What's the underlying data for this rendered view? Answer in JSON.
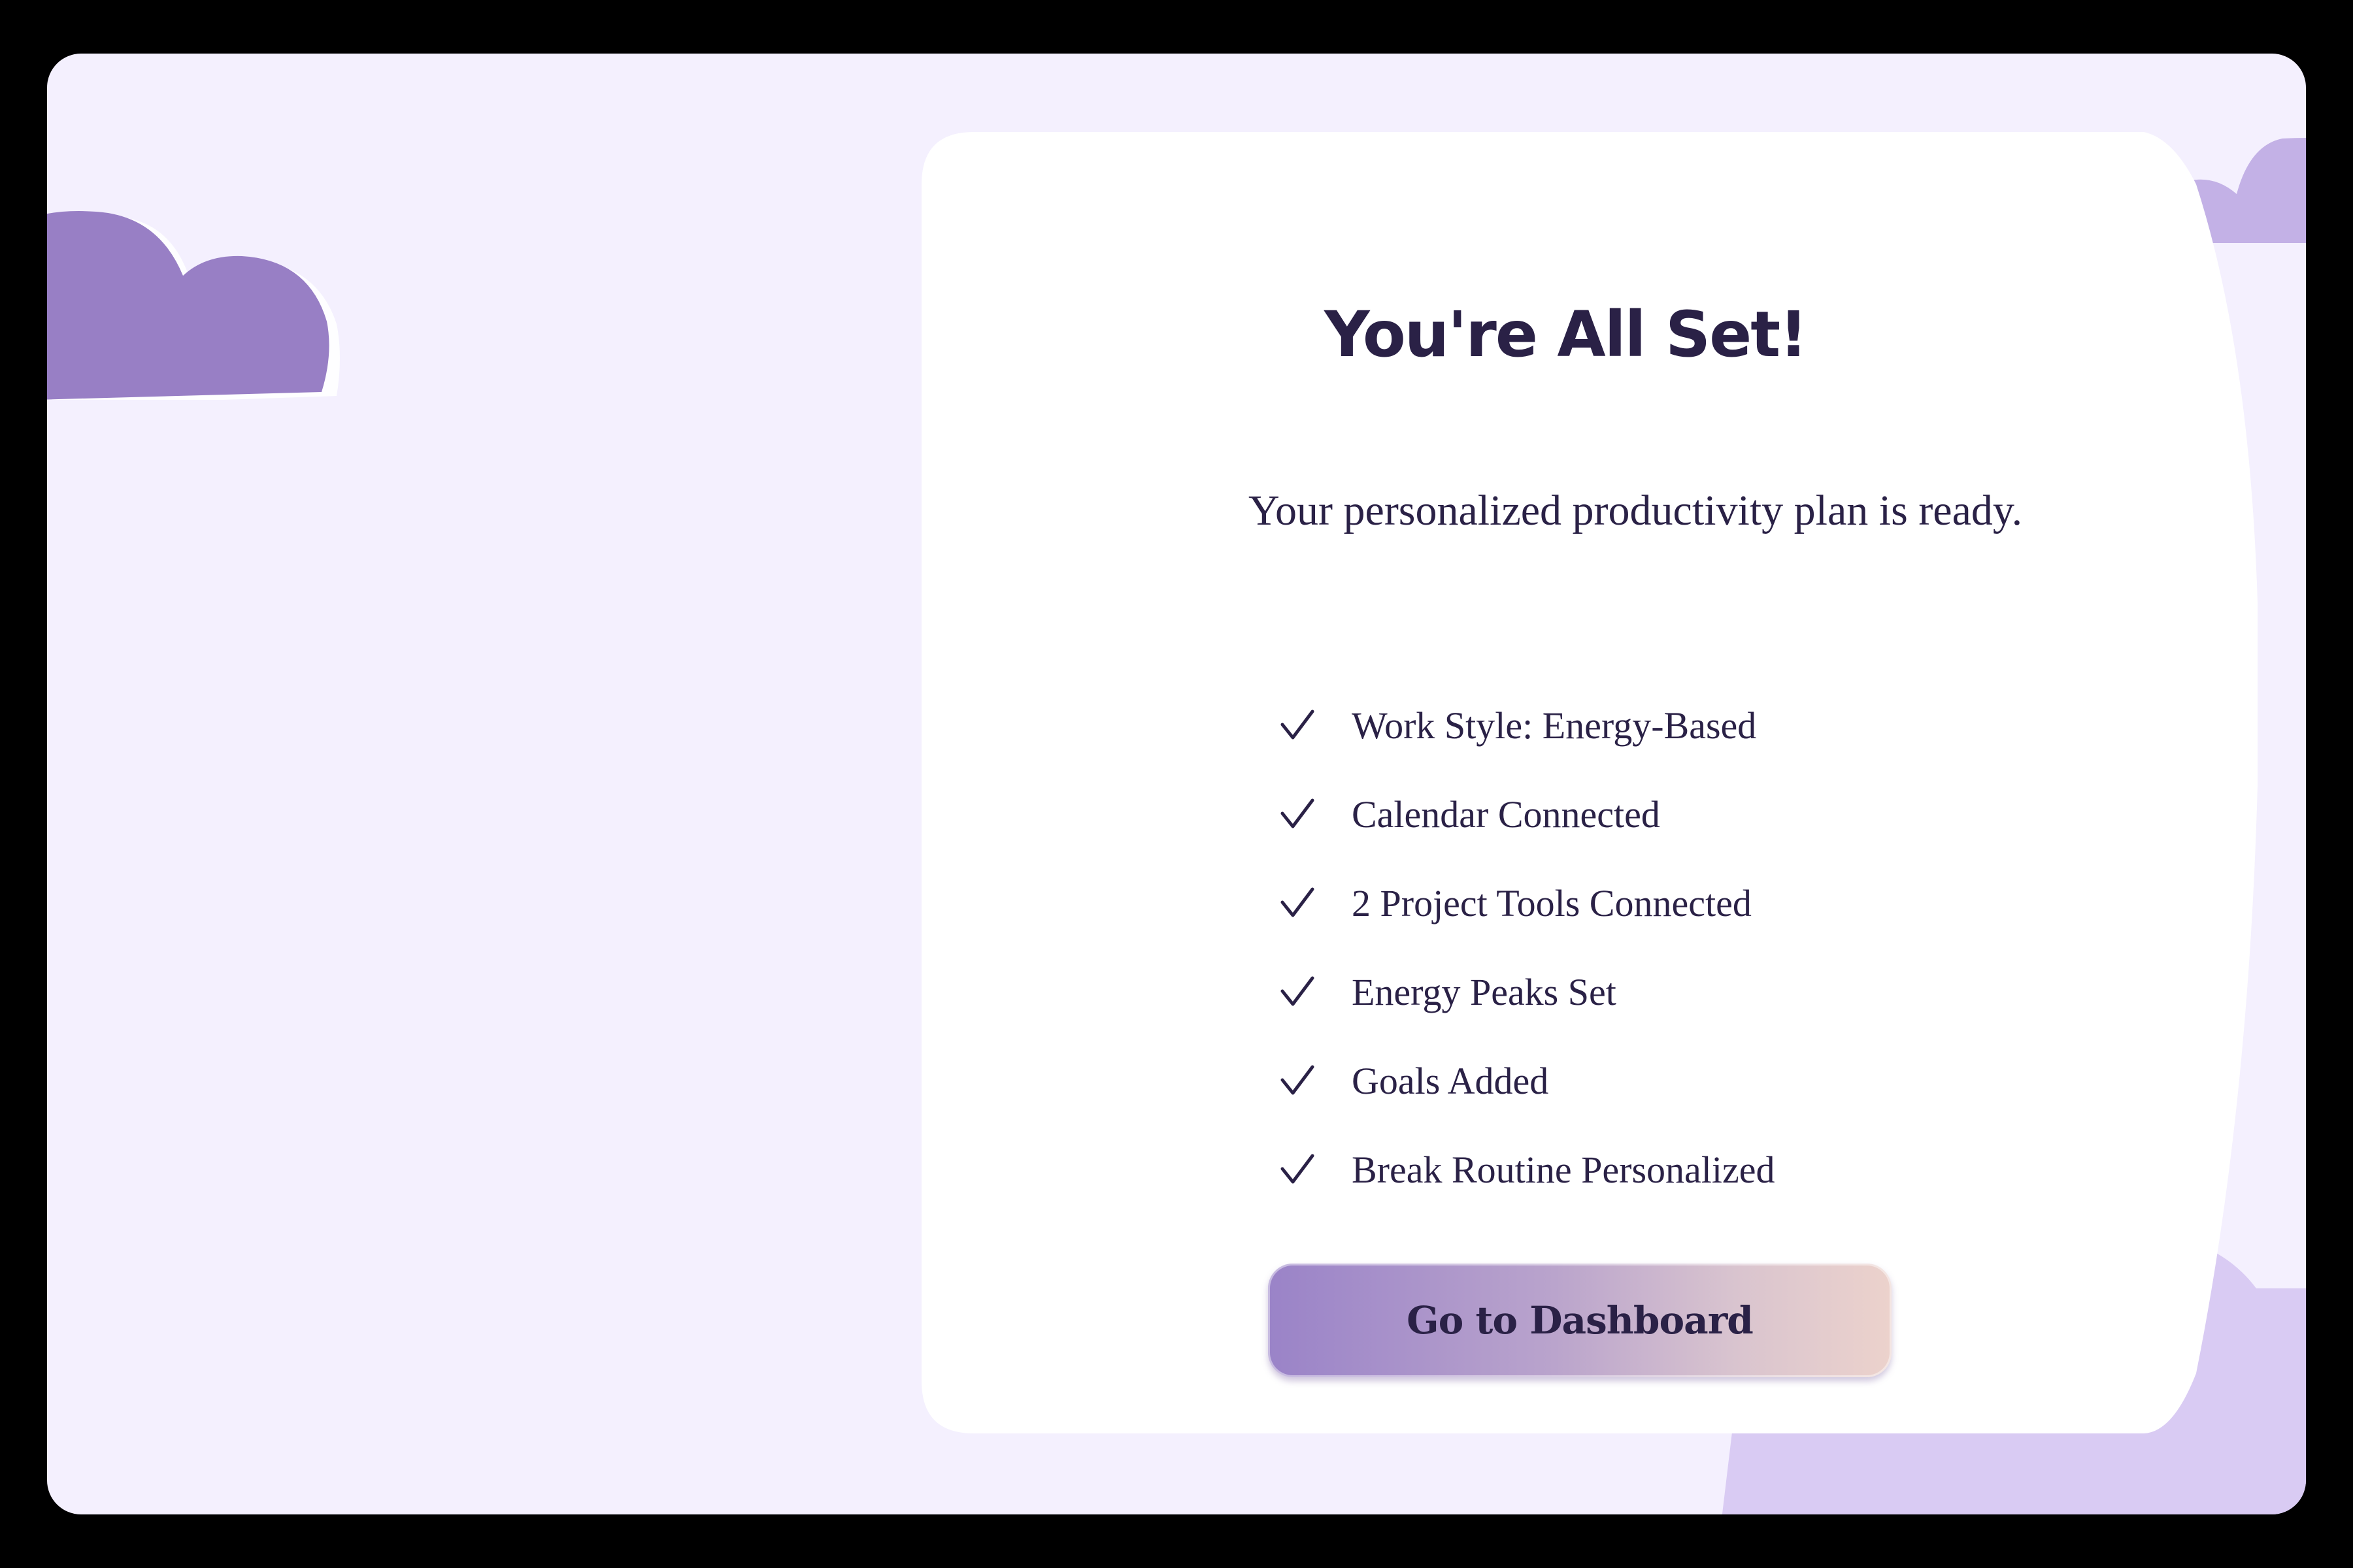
{
  "onboarding_complete": {
    "title": "You're All Set!",
    "subtitle": "Your personalized productivity plan is ready.",
    "checklist": [
      {
        "label": "Work Style: Energy-Based",
        "icon": "check-icon"
      },
      {
        "label": "Calendar Connected",
        "icon": "check-icon"
      },
      {
        "label": "2 Project Tools Connected",
        "icon": "check-icon"
      },
      {
        "label": "Energy Peaks Set",
        "icon": "check-icon"
      },
      {
        "label": "Goals Added",
        "icon": "check-icon"
      },
      {
        "label": "Break Routine Personalized",
        "icon": "check-icon"
      }
    ],
    "cta_label": "Go to Dashboard"
  },
  "colors": {
    "background": "#f4f0fe",
    "card": "#ffffff",
    "text": "#2a2146",
    "cloud_primary": "#987fc5",
    "cloud_light": "#c3b1e6",
    "cloud_lighter": "#d9cbf3",
    "button_gradient_start": "#9a83c8",
    "button_gradient_end": "#ecd2cc"
  }
}
